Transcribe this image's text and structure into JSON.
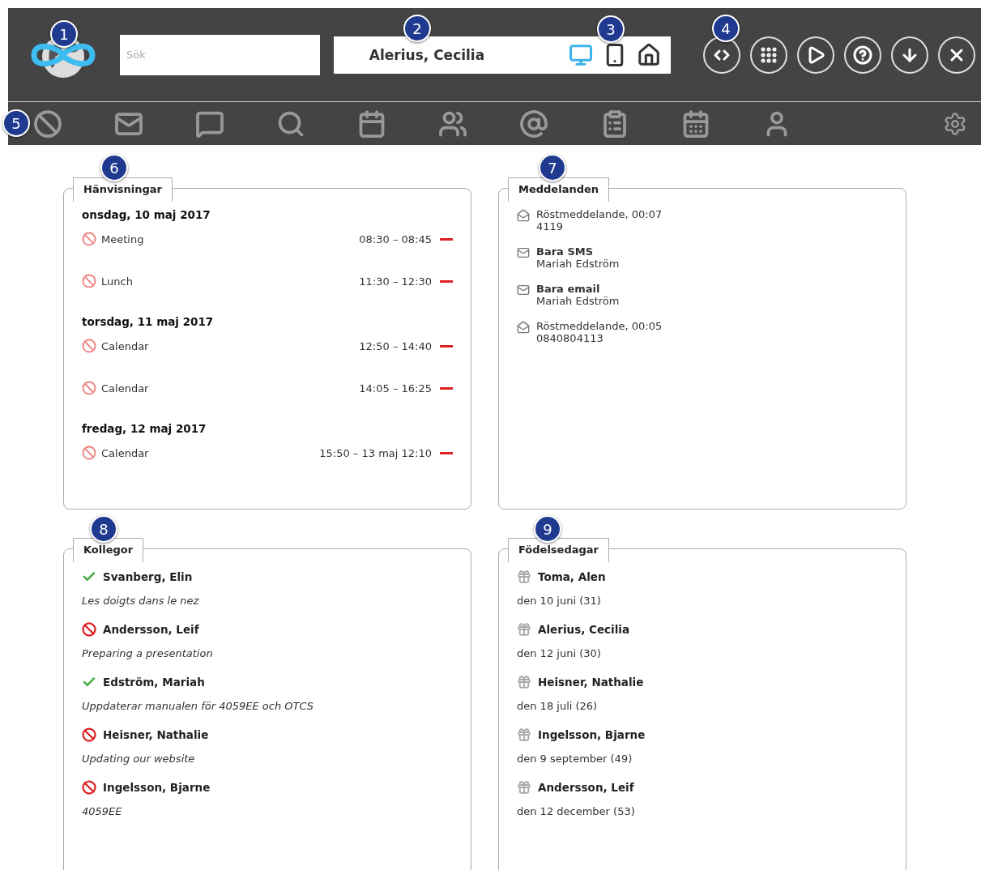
{
  "search": {
    "placeholder": "Sök"
  },
  "user": {
    "name": "Alerius, Cecilia"
  },
  "devices": [
    {
      "kind": "computer",
      "selected": true
    },
    {
      "kind": "mobile",
      "selected": false
    },
    {
      "kind": "home",
      "selected": false
    }
  ],
  "callouts": [
    "1",
    "2",
    "3",
    "4",
    "5",
    "6",
    "7",
    "8",
    "9"
  ],
  "appointments": {
    "title": "Hänvisningar",
    "days": [
      {
        "date": "onsdag, 10 maj 2017",
        "items": [
          {
            "label": "Meeting",
            "time": "08:30 – 08:45"
          },
          {
            "label": "Lunch",
            "time": "11:30 – 12:30"
          }
        ]
      },
      {
        "date": "torsdag, 11 maj 2017",
        "items": [
          {
            "label": "Calendar",
            "time": "12:50 – 14:40"
          },
          {
            "label": "Calendar",
            "time": "14:05 – 16:25"
          }
        ]
      },
      {
        "date": "fredag, 12 maj 2017",
        "items": [
          {
            "label": "Calendar",
            "time": "15:50 – 13 maj 12:10"
          }
        ]
      }
    ]
  },
  "messages": {
    "title": "Meddelanden",
    "items": [
      {
        "kind": "voicemail",
        "title": "Röstmeddelande, 00:07",
        "detail": "4119"
      },
      {
        "kind": "text",
        "title": "Bara SMS",
        "detail": "Mariah Edström"
      },
      {
        "kind": "text",
        "title": "Bara email",
        "detail": "Mariah Edström"
      },
      {
        "kind": "voicemail",
        "title": "Röstmeddelande, 00:05",
        "detail": "0840804113"
      }
    ]
  },
  "colleagues": {
    "title": "Kollegor",
    "items": [
      {
        "available": true,
        "name": "Svanberg, Elin",
        "note": "Les doigts dans le nez"
      },
      {
        "available": false,
        "name": "Andersson, Leif",
        "note": "Preparing a presentation"
      },
      {
        "available": true,
        "name": "Edström, Mariah",
        "note": "Uppdaterar manualen för 4059EE och OTCS"
      },
      {
        "available": false,
        "name": "Heisner, Nathalie",
        "note": "Updating our website"
      },
      {
        "available": false,
        "name": "Ingelsson, Bjarne",
        "note": "4059EE"
      }
    ]
  },
  "birthdays": {
    "title": "Födelsedagar",
    "items": [
      {
        "name": "Toma, Alen",
        "date": "den 10 juni (31)"
      },
      {
        "name": "Alerius, Cecilia",
        "date": "den 12 juni (30)"
      },
      {
        "name": "Heisner, Nathalie",
        "date": "den 18 juli (26)"
      },
      {
        "name": "Ingelsson, Bjarne",
        "date": "den 9 september (49)"
      },
      {
        "name": "Andersson, Leif",
        "date": "den 12 december (53)"
      }
    ]
  }
}
